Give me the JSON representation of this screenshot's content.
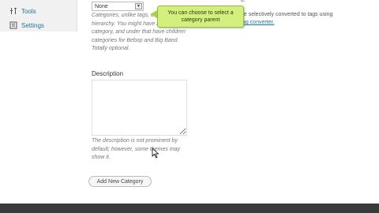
{
  "sidebar": {
    "items": [
      {
        "label": "Tools",
        "icon": "tools-icon"
      },
      {
        "label": "Settings",
        "icon": "settings-icon"
      }
    ]
  },
  "parent_select": {
    "value": "None"
  },
  "parent_help": "Categories, unlike tags, can have a hierarchy. You might have a Jazz category, and under that have children categories for Bebop and Big Band. Totally optional.",
  "right_column": {
    "top_fragment": "d.",
    "line1": "be selectively converted to tags using",
    "line2": "tag converter."
  },
  "description": {
    "label": "Description",
    "value": "",
    "help": "The description is not prominent by default; however, some themes may show it."
  },
  "add_button": "Add New Category",
  "callout": "You can choose to select a category parent",
  "bottom_bar": {
    "text": "",
    "right": ""
  }
}
